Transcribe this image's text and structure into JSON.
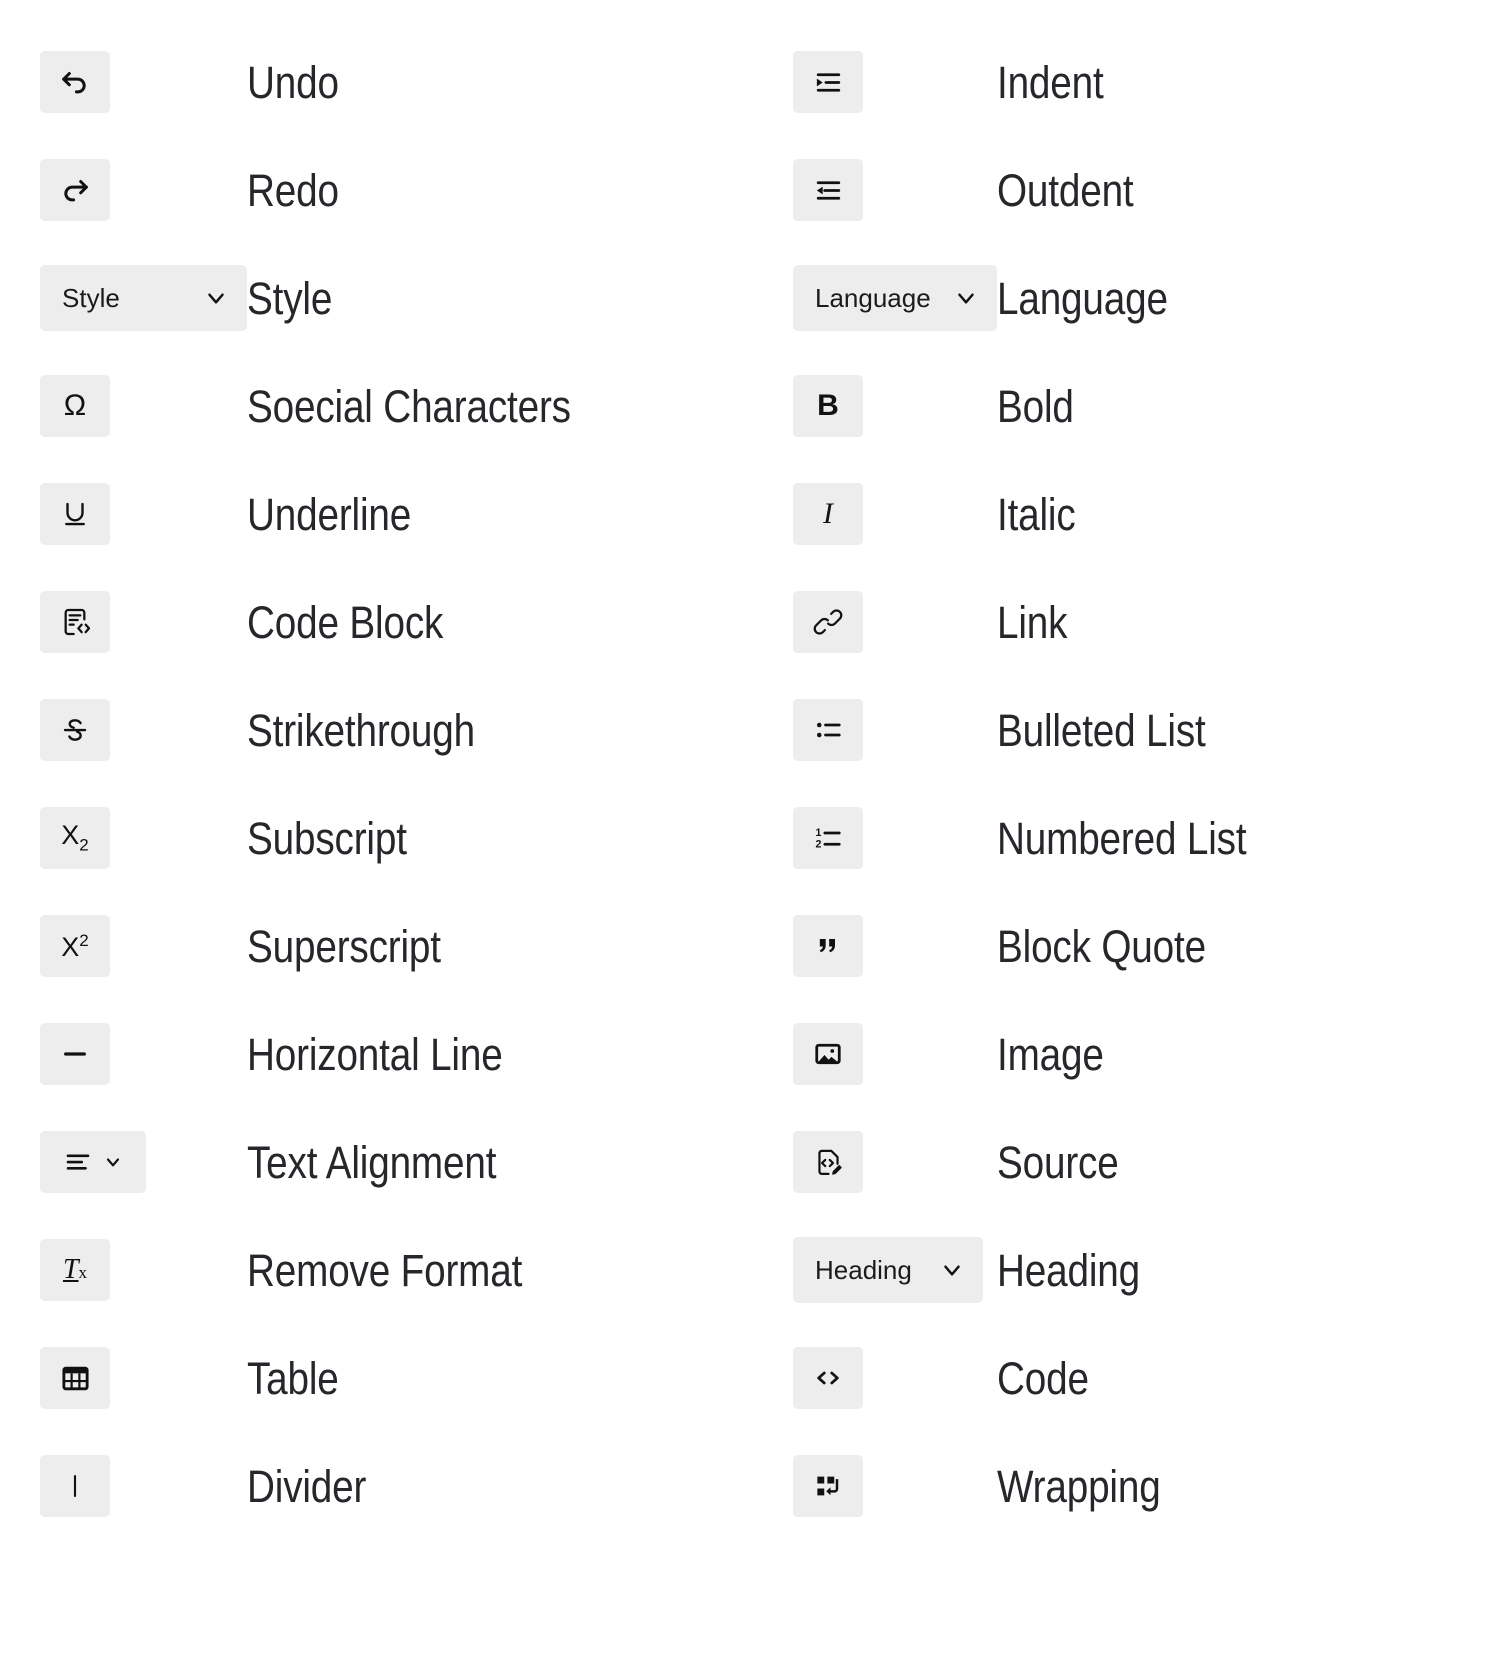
{
  "background_color": "#ffffff",
  "chip_color": "#ededed",
  "label_color": "#26272b",
  "icon_color": "#111111",
  "left_column": [
    {
      "label": "Undo",
      "icon": "undo-arrow-icon",
      "control": "icon-button"
    },
    {
      "label": "Redo",
      "icon": "redo-arrow-icon",
      "control": "icon-button"
    },
    {
      "label": "Style",
      "icon": "chevron-down-icon",
      "control": "dropdown",
      "value": "Style"
    },
    {
      "label": "Soecial Characters",
      "icon": "omega-icon",
      "control": "icon-button"
    },
    {
      "label": "Underline",
      "icon": "underline-icon",
      "control": "icon-button"
    },
    {
      "label": "Code Block",
      "icon": "code-block-icon",
      "control": "icon-button"
    },
    {
      "label": "Strikethrough",
      "icon": "strikethrough-icon",
      "control": "icon-button"
    },
    {
      "label": "Subscript",
      "icon": "subscript-icon",
      "control": "icon-button"
    },
    {
      "label": "Superscript",
      "icon": "superscript-icon",
      "control": "icon-button"
    },
    {
      "label": "Horizontal Line",
      "icon": "horizontal-line-icon",
      "control": "icon-button"
    },
    {
      "label": "Text Alignment",
      "icon": "align-left-icon",
      "control": "split-button"
    },
    {
      "label": "Remove Format",
      "icon": "remove-format-icon",
      "control": "icon-button"
    },
    {
      "label": "Table",
      "icon": "table-grid-icon",
      "control": "icon-button"
    },
    {
      "label": "Divider",
      "icon": "vertical-bar-icon",
      "control": "icon-button"
    }
  ],
  "right_column": [
    {
      "label": "Indent",
      "icon": "indent-icon",
      "control": "icon-button"
    },
    {
      "label": "Outdent",
      "icon": "outdent-icon",
      "control": "icon-button"
    },
    {
      "label": "Language",
      "icon": "chevron-down-icon",
      "control": "dropdown",
      "value": "Language"
    },
    {
      "label": "Bold",
      "icon": "bold-icon",
      "control": "icon-button"
    },
    {
      "label": "Italic",
      "icon": "italic-icon",
      "control": "icon-button"
    },
    {
      "label": "Link",
      "icon": "link-chain-icon",
      "control": "icon-button"
    },
    {
      "label": "Bulleted List",
      "icon": "bulleted-list-icon",
      "control": "icon-button"
    },
    {
      "label": "Numbered List",
      "icon": "numbered-list-icon",
      "control": "icon-button"
    },
    {
      "label": "Block Quote",
      "icon": "block-quote-icon",
      "control": "icon-button"
    },
    {
      "label": "Image",
      "icon": "image-icon",
      "control": "icon-button"
    },
    {
      "label": "Source",
      "icon": "source-edit-icon",
      "control": "icon-button"
    },
    {
      "label": "Heading",
      "icon": "chevron-down-icon",
      "control": "dropdown",
      "value": "Heading"
    },
    {
      "label": "Code",
      "icon": "code-angle-icon",
      "control": "icon-button"
    },
    {
      "label": "Wrapping",
      "icon": "wrapping-icon",
      "control": "icon-button"
    }
  ]
}
